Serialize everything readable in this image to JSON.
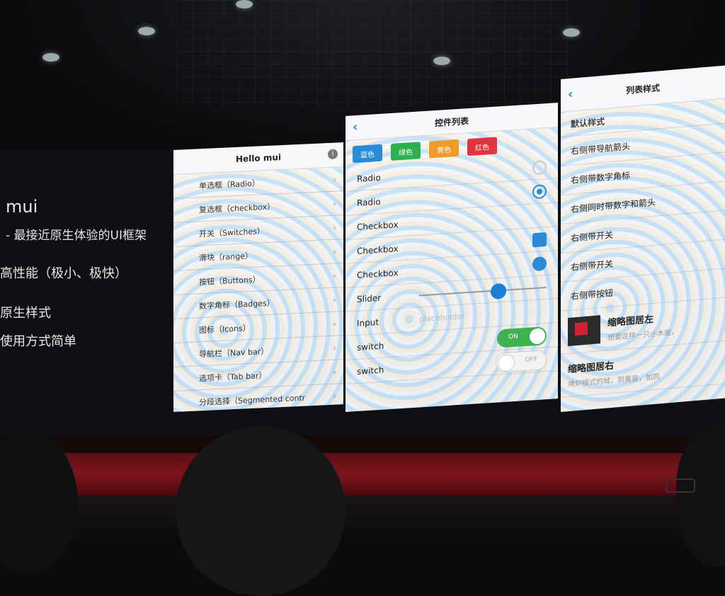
{
  "slide": {
    "title": "mui",
    "subtitle": "- 最接近原生体验的UI框架",
    "bullets": [
      "高性能（极小、极快）",
      "原生样式",
      "使用方式简单"
    ]
  },
  "screen1": {
    "title": "Hello mui",
    "items": [
      "单选框（Radio）",
      "复选框（checkbox）",
      "开关（Switches）",
      "滑块（range）",
      "按钮（Buttons）",
      "数字角标（Badges）",
      "图标（Icons）",
      "导航栏（Nav bar）",
      "选项卡（Tab bar）",
      "分段选择（Segmented contr"
    ]
  },
  "screen2": {
    "title": "控件列表",
    "color_buttons": [
      {
        "label": "蓝色",
        "color": "#2a8bd8"
      },
      {
        "label": "绿色",
        "color": "#2fb04f"
      },
      {
        "label": "黄色",
        "color": "#f09a2a"
      },
      {
        "label": "红色",
        "color": "#e0343f"
      }
    ],
    "rows": {
      "radio1": "Radio",
      "radio2": "Radio",
      "checkbox1": "Checkbox",
      "checkbox2": "Checkbox",
      "checkbox3": "Checkbox",
      "slider": "Slider",
      "input": "Input",
      "input_placeholder": "placeholder",
      "switch1": "switch",
      "switch2": "switch"
    },
    "slider_value": 0.62,
    "switch_on_label": "ON",
    "switch_off_label": "OFF"
  },
  "screen3": {
    "title": "列表样式",
    "items": [
      "默认样式",
      "右侧带导航箭头",
      "右侧带数字角标",
      "右侧同时带数字和箭头",
      "右侧带开关",
      "右侧带开关",
      "右侧带按钮"
    ],
    "thumb_items": [
      {
        "title": "缩略图居左",
        "subtitle": "想要这样一只小木屋，"
      },
      {
        "title": "缩略图居右",
        "subtitle": "烤炉模式的城，到黄昏，如同"
      }
    ]
  }
}
